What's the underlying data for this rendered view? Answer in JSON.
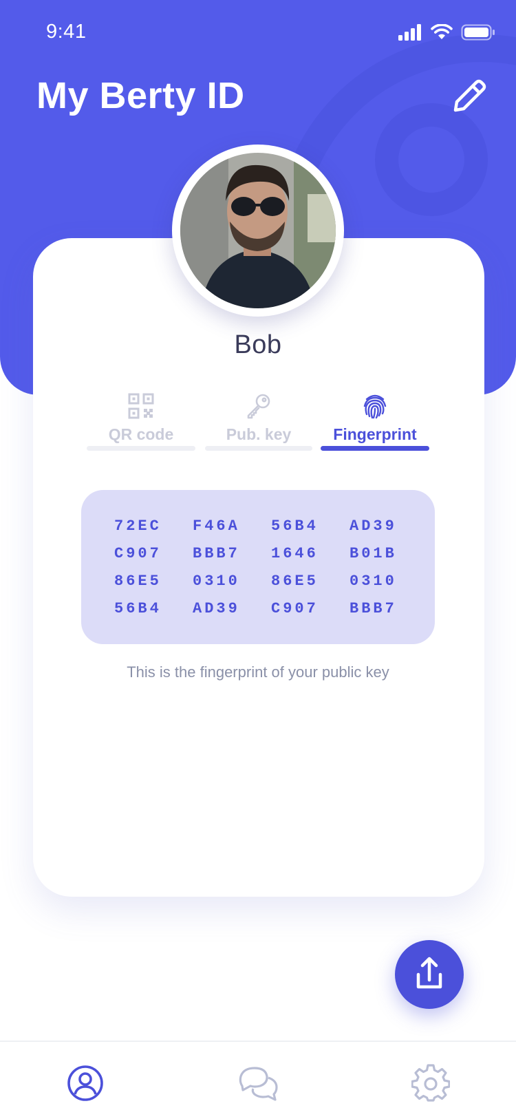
{
  "status_bar": {
    "time": "9:41",
    "icons": [
      "signal-icon",
      "wifi-icon",
      "battery-icon"
    ]
  },
  "header": {
    "title": "My Berty ID",
    "edit_icon": "pencil-icon",
    "background_color": "#535bea"
  },
  "profile": {
    "avatar": "profile-photo",
    "name": "Bob"
  },
  "tabs": [
    {
      "label": "QR code",
      "icon": "qr-code-icon",
      "active": false
    },
    {
      "label": "Pub. key",
      "icon": "key-icon",
      "active": false
    },
    {
      "label": "Fingerprint",
      "icon": "fingerprint-icon",
      "active": true
    }
  ],
  "fingerprint": {
    "rows": [
      [
        "72EC",
        "F46A",
        "56B4",
        "AD39"
      ],
      [
        "C907",
        "BBB7",
        "1646",
        "B01B"
      ],
      [
        "86E5",
        "0310",
        "86E5",
        "0310"
      ],
      [
        "56B4",
        "AD39",
        "C907",
        "BBB7"
      ]
    ],
    "caption": "This is the fingerprint of your public key"
  },
  "share_button": {
    "icon": "share-upload-icon"
  },
  "bottom_nav": [
    {
      "icon": "account-icon",
      "active": true
    },
    {
      "icon": "chat-bubbles-icon",
      "active": false
    },
    {
      "icon": "settings-gear-icon",
      "active": false
    }
  ],
  "colors": {
    "accent": "#4b50da",
    "fingerprint_box": "#dcdcf8",
    "inactive": "#c9cbd9"
  }
}
